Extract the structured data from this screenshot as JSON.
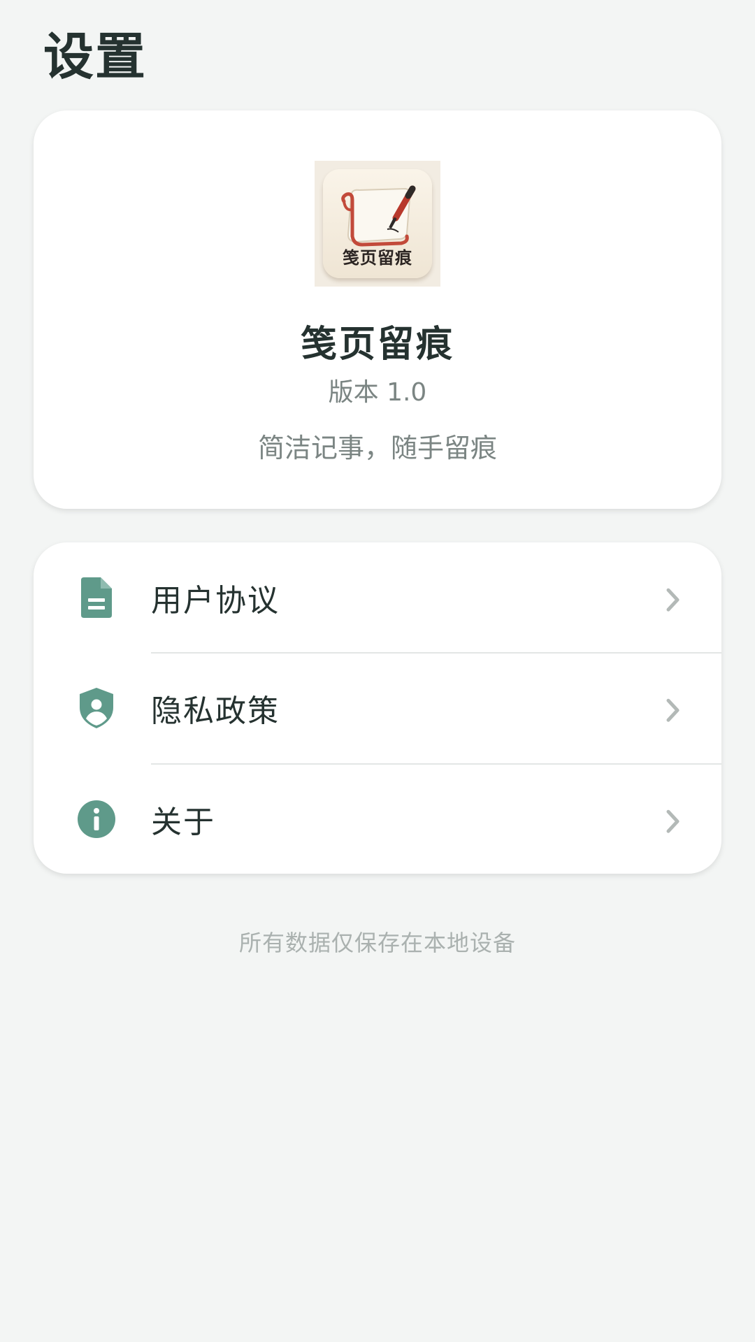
{
  "header": {
    "title": "设置"
  },
  "app_info": {
    "logo_text": "笺页留痕",
    "name": "笺页留痕",
    "version": "版本 1.0",
    "slogan": "简洁记事，随手留痕"
  },
  "menu": {
    "items": [
      {
        "label": "用户协议",
        "icon": "document-icon"
      },
      {
        "label": "隐私政策",
        "icon": "shield-user-icon"
      },
      {
        "label": "关于",
        "icon": "info-icon"
      }
    ]
  },
  "footer": {
    "note": "所有数据仅保存在本地设备"
  },
  "colors": {
    "accent": "#5f9a8a",
    "background": "#f3f5f4",
    "card": "#ffffff",
    "title_text": "#253230",
    "secondary_text": "#7b8583",
    "footer_text": "#aab1af"
  }
}
